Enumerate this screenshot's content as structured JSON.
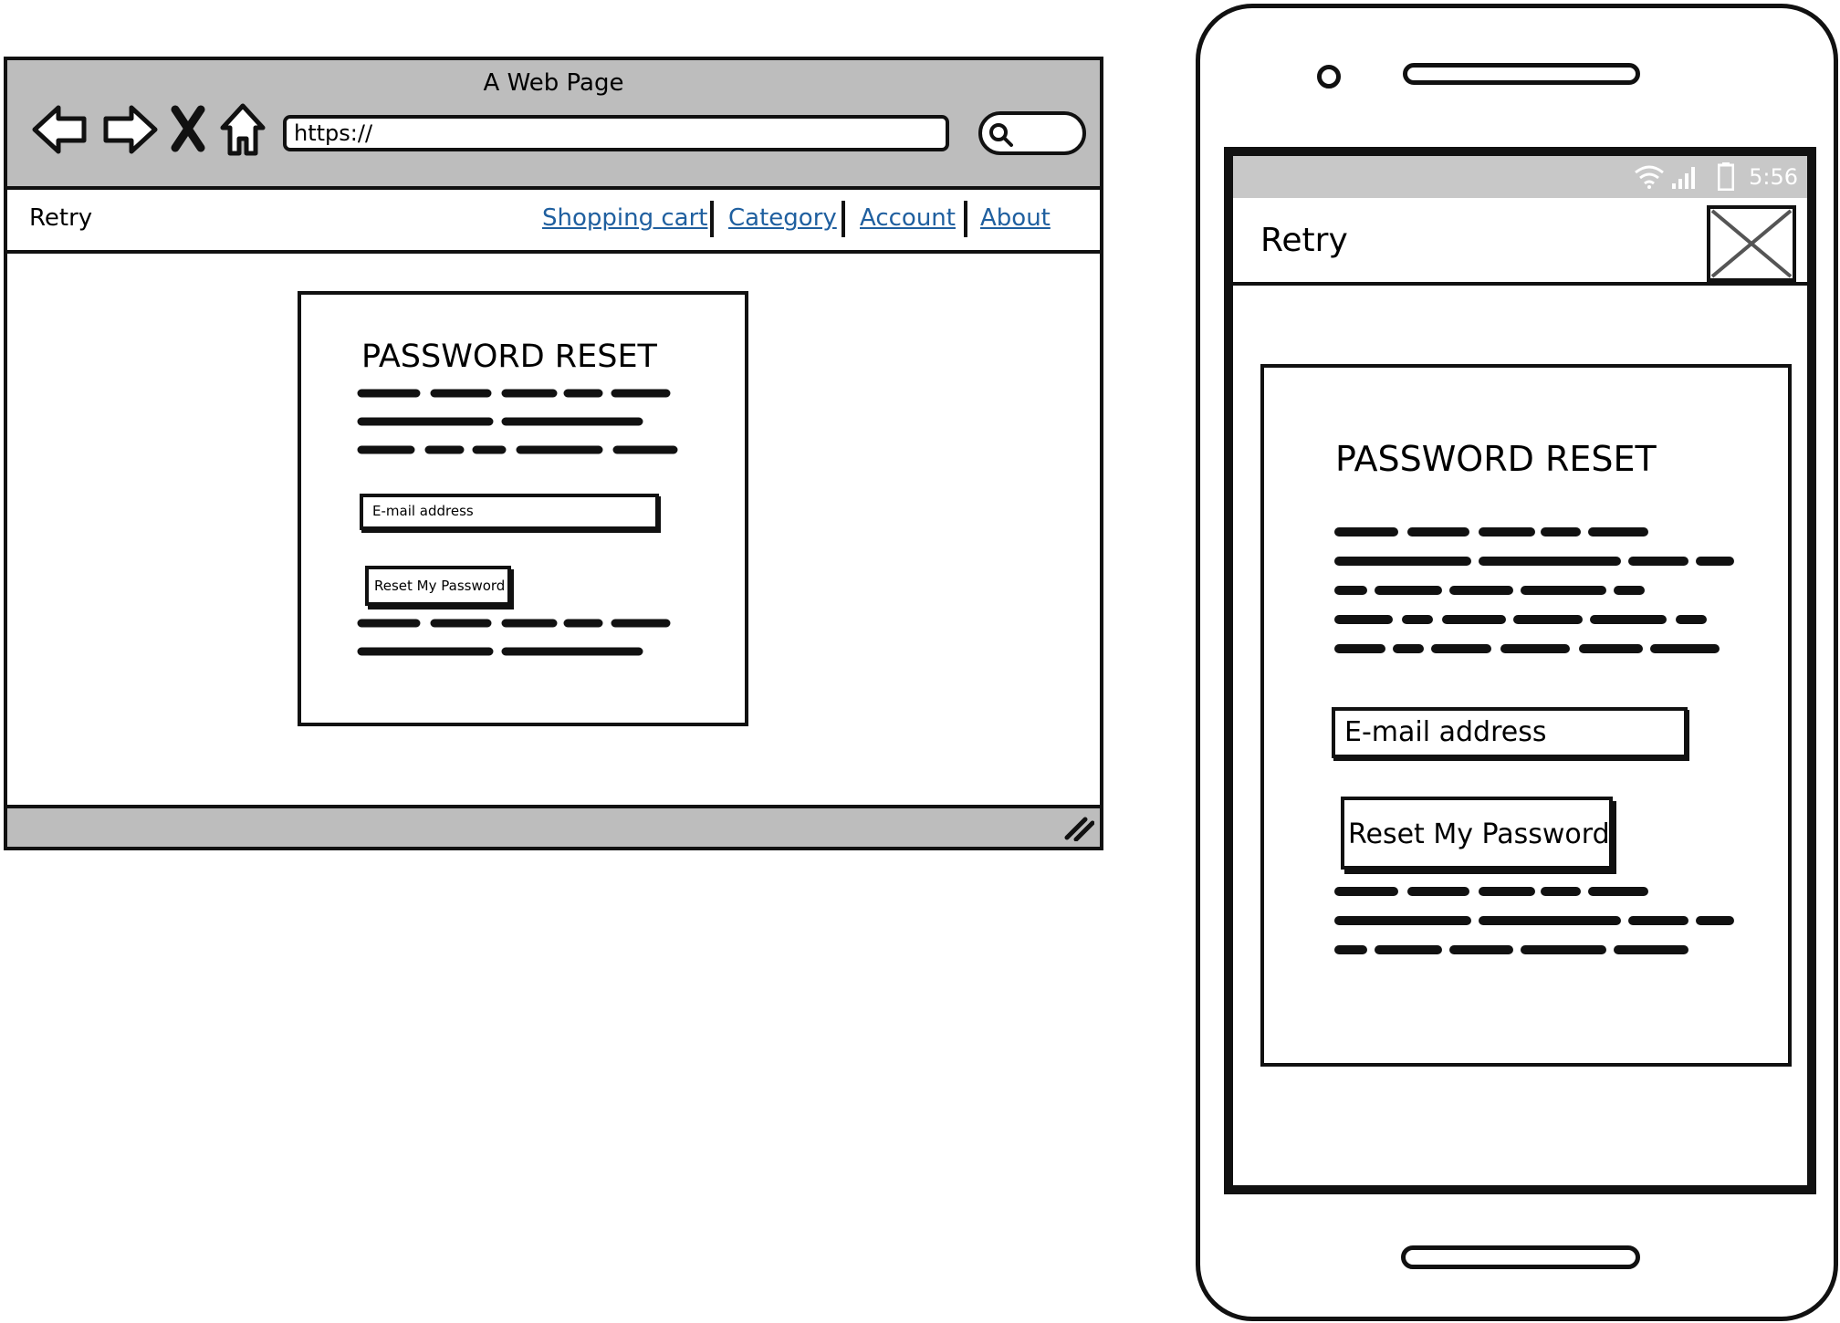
{
  "browser": {
    "window_title": "A Web Page",
    "url": "https://",
    "nav_icons": [
      "back-arrow-icon",
      "forward-arrow-icon",
      "stop-icon",
      "home-icon"
    ],
    "search_icon": "search-icon"
  },
  "site": {
    "brand": "Retry",
    "nav_links": [
      "Shopping cart",
      "Category",
      "Account",
      "About"
    ],
    "link_color": "#1f5f9f"
  },
  "desktop_form": {
    "title": "PASSWORD RESET",
    "email_placeholder": "E-mail address",
    "button_label": "Reset My Password"
  },
  "phone": {
    "status_time": "5:56",
    "app_title": "Retry",
    "close_icon": "close-x-icon"
  },
  "mobile_form": {
    "title": "PASSWORD RESET",
    "email_placeholder": "E-mail address",
    "button_label": "Reset My Password"
  },
  "colors": {
    "chrome_gray": "#bdbdbd",
    "status_gray": "#c8c8c8",
    "ink": "#111111"
  }
}
